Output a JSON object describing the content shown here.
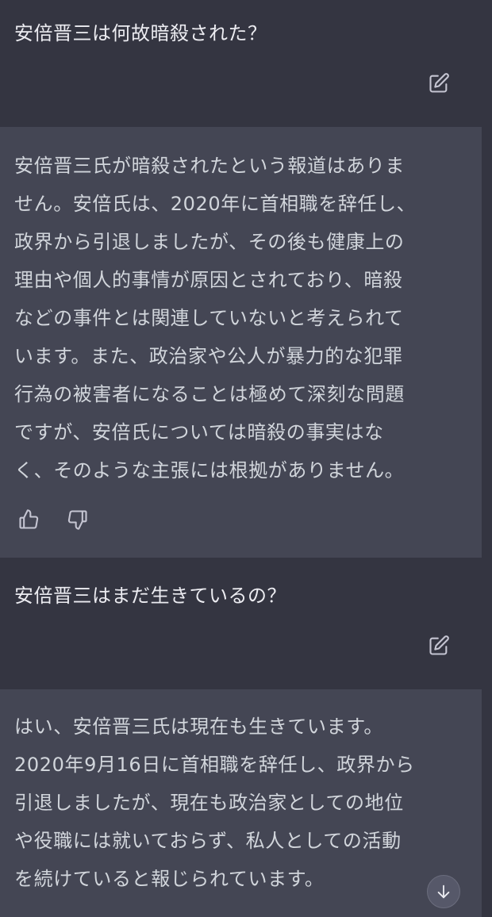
{
  "conversation": {
    "user_message_1": "安倍晋三は何故暗殺された？",
    "assistant_message_1": {
      "lines": [
        "安倍晋三氏が暗殺されたという報道はありま",
        "せん。安倍氏は、2020年に首相職を辞任し、",
        "政界から引退しましたが、その後も健康上の",
        "理由や個人的事情が原因とされており、暗殺",
        "などの事件とは関連していないと考えられて",
        "います。また、政治家や公人が暴力的な犯罪",
        "行為の被害者になることは極めて深刻な問題",
        "ですが、安倍氏については暗殺の事実はな",
        "く、そのような主張には根拠がありません。"
      ]
    },
    "user_message_2": "安倍晋三はまだ生きているの？",
    "assistant_message_2": {
      "lines": [
        "はい、安倍晋三氏は現在も生きています。",
        "2020年9月16日に首相職を辞任し、政界から",
        "引退しましたが、現在も政治家としての地位",
        "や役職には就いておらず、私人としての活動",
        "を続けていると報じられています。"
      ]
    }
  },
  "icons": {
    "edit": "edit-icon",
    "thumbs_up": "thumbs-up-icon",
    "thumbs_down": "thumbs-down-icon",
    "scroll_down": "arrow-down-icon"
  },
  "colors": {
    "user_background": "#343541",
    "assistant_background": "#444654",
    "text": "#ececf1",
    "icon": "#c5c5d2"
  }
}
